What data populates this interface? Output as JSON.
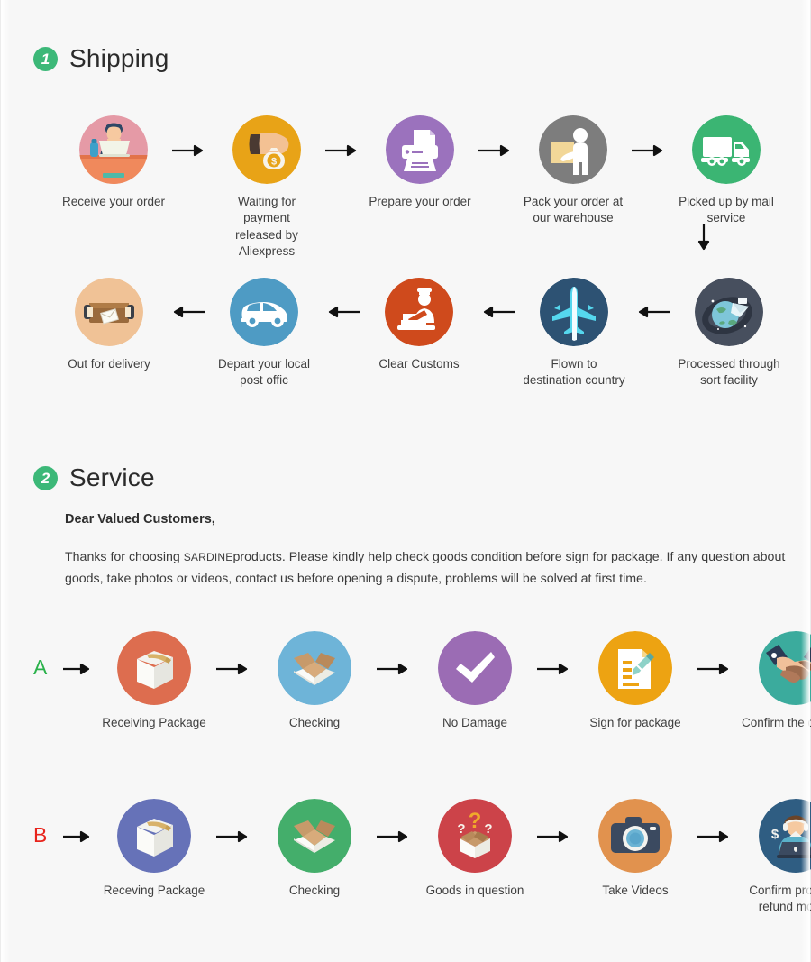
{
  "sections": {
    "shipping": {
      "number": "1",
      "title": "Shipping",
      "badge_color": "#3cb878"
    },
    "service": {
      "number": "2",
      "title": "Service",
      "badge_color": "#3cb878"
    }
  },
  "shipping_row1": {
    "direction": "left-to-right",
    "steps": [
      {
        "label": "Receive your order",
        "icon": "person-at-desk-icon",
        "circle_color": "#e59aa6"
      },
      {
        "label": "Waiting for payment\nreleased by Aliexpress",
        "icon": "hand-money-bag-icon",
        "circle_color": "#e8a317"
      },
      {
        "label": "Prepare your order",
        "icon": "printer-icon",
        "circle_color": "#9b72bd"
      },
      {
        "label": "Pack your order at\nour warehouse",
        "icon": "worker-packing-icon",
        "circle_color": "#7d7d7d"
      },
      {
        "label": "Picked up by mail service",
        "icon": "delivery-truck-icon",
        "circle_color": "#3bb573"
      }
    ],
    "arrow": "arrow-right-icon"
  },
  "transition": {
    "arrow": "arrow-down-icon"
  },
  "shipping_row2": {
    "direction": "right-to-left",
    "steps": [
      {
        "label": "Out for delivery",
        "icon": "open-parcel-icon",
        "circle_color": "#f0c296"
      },
      {
        "label": "Depart your local\npost offic",
        "icon": "delivery-van-icon",
        "circle_color": "#4e9bc4"
      },
      {
        "label": "Clear  Customs",
        "icon": "customs-officer-icon",
        "circle_color": "#cf4a1c"
      },
      {
        "label": "Flown to\ndestination country",
        "icon": "airplane-icon",
        "circle_color": "#2d5273"
      },
      {
        "label": "Processed through\nsort facility",
        "icon": "globe-sorting-icon",
        "circle_color": "#474f5e"
      }
    ],
    "arrow": "arrow-left-icon"
  },
  "service_text": {
    "greeting": "Dear Valued Customers,",
    "body_part1": "Thanks for choosing ",
    "brand": "SARDINE",
    "body_part2": "products. Please kindly help check goods condition before sign for package. If any question about goods, take photos or videos, contact us before opening a dispute, problems will be solved at first time."
  },
  "service_row_a": {
    "label": "A",
    "label_color": "#2bb24c",
    "arrow": "arrow-right-icon",
    "steps": [
      {
        "label": "Receiving Package",
        "icon": "sealed-box-icon",
        "circle_color": "#dd6d4f"
      },
      {
        "label": "Checking",
        "icon": "open-box-icon",
        "circle_color": "#6eb4d8"
      },
      {
        "label": "No Damage",
        "icon": "checkmark-icon",
        "circle_color": "#9b6cb4"
      },
      {
        "label": "Sign for package",
        "icon": "signed-form-icon",
        "circle_color": "#eda312"
      },
      {
        "label": "Confirm the delivery",
        "icon": "handshake-icon",
        "circle_color": "#3bab9d"
      }
    ]
  },
  "service_row_b": {
    "label": "B",
    "label_color": "#e8241c",
    "arrow": "arrow-right-icon",
    "steps": [
      {
        "label": "Receving Package",
        "icon": "sealed-box-icon",
        "circle_color": "#6672b8"
      },
      {
        "label": "Checking",
        "icon": "open-box-icon",
        "circle_color": "#44ae6b"
      },
      {
        "label": "Goods in question",
        "icon": "question-box-icon",
        "circle_color": "#cc4349"
      },
      {
        "label": "Take Videos",
        "icon": "camera-icon",
        "circle_color": "#e1924e"
      },
      {
        "label": "Confirm problem,\nrefund money",
        "icon": "support-agent-icon",
        "circle_color": "#2f5d82"
      }
    ]
  }
}
